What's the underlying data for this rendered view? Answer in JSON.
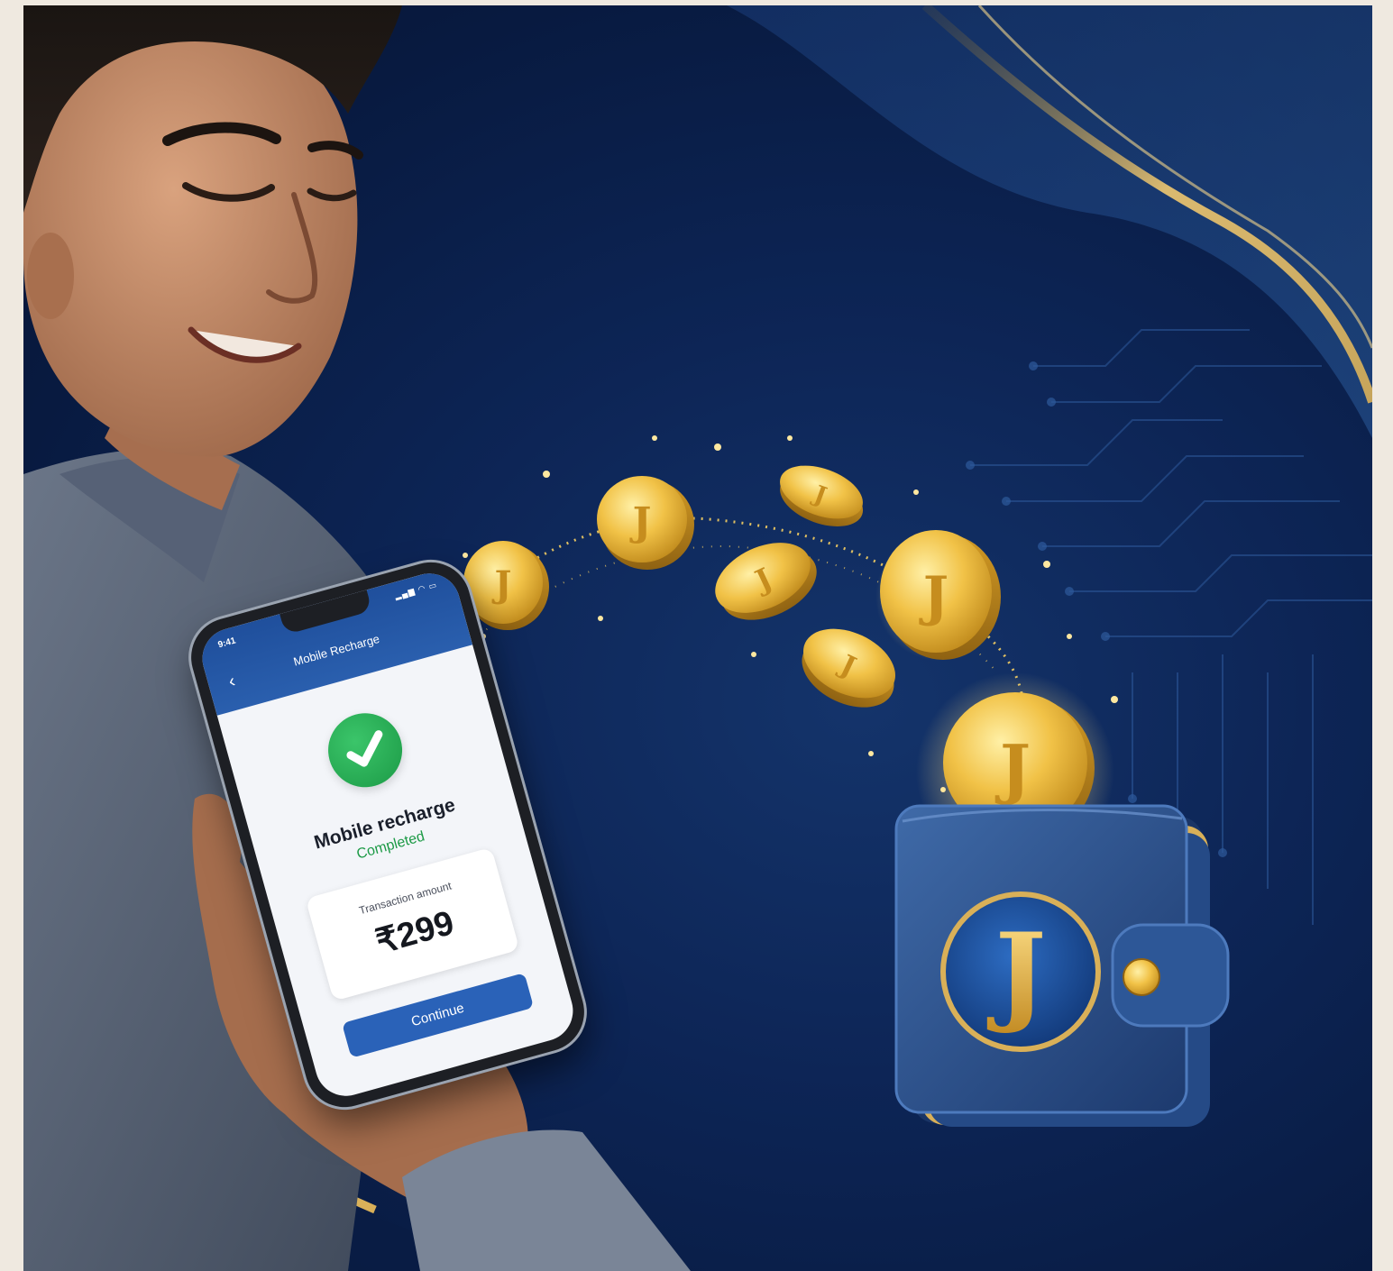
{
  "phone": {
    "status_time": "9:41",
    "header_title": "Mobile Recharge",
    "status_title": "Mobile recharge",
    "status_subtitle": "Completed",
    "amount_label": "Transaction amount",
    "amount_value": "₹299",
    "continue_label": "Continue"
  },
  "brand": {
    "wallet_letter": "J",
    "coin_letter": "J"
  },
  "colors": {
    "background_navy": "#0d2556",
    "accent_gold": "#e6b43c",
    "success_green": "#1c9a46",
    "button_blue": "#2a62b8",
    "wallet_blue": "#2b4f86"
  },
  "icons": {
    "check": "check-circle-icon",
    "back": "chevron-left-icon",
    "signal": "signal-icon",
    "wifi": "wifi-icon",
    "battery": "battery-icon"
  }
}
